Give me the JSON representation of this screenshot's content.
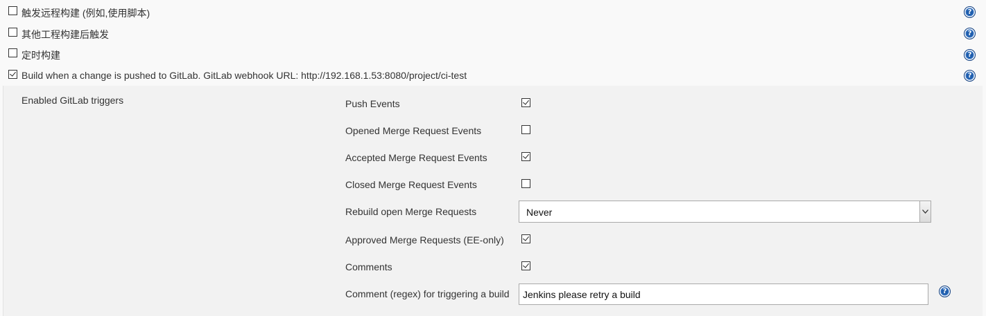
{
  "trigger_options": [
    {
      "label": "触发远程构建 (例如,使用脚本)",
      "checked": false
    },
    {
      "label": "其他工程构建后触发",
      "checked": false
    },
    {
      "label": "定时构建",
      "checked": false
    },
    {
      "label": "Build when a change is pushed to GitLab. GitLab webhook URL: http://192.168.1.53:8080/project/ci-test",
      "checked": true
    }
  ],
  "gitlab_panel": {
    "section_label": "Enabled GitLab triggers",
    "triggers": [
      {
        "label": "Push Events",
        "checked": true
      },
      {
        "label": "Opened Merge Request Events",
        "checked": false
      },
      {
        "label": "Accepted Merge Request Events",
        "checked": true
      },
      {
        "label": "Closed Merge Request Events",
        "checked": false
      }
    ],
    "rebuild": {
      "label": "Rebuild open Merge Requests",
      "value": "Never"
    },
    "approved": {
      "label": "Approved Merge Requests (EE-only)",
      "checked": true
    },
    "comments": {
      "label": "Comments",
      "checked": true
    },
    "comment_regex": {
      "label": "Comment (regex) for triggering a build",
      "value": "Jenkins please retry a build"
    }
  },
  "help_icon": {
    "name": "help-icon",
    "glyph": "?",
    "color": "#1f5dab"
  }
}
